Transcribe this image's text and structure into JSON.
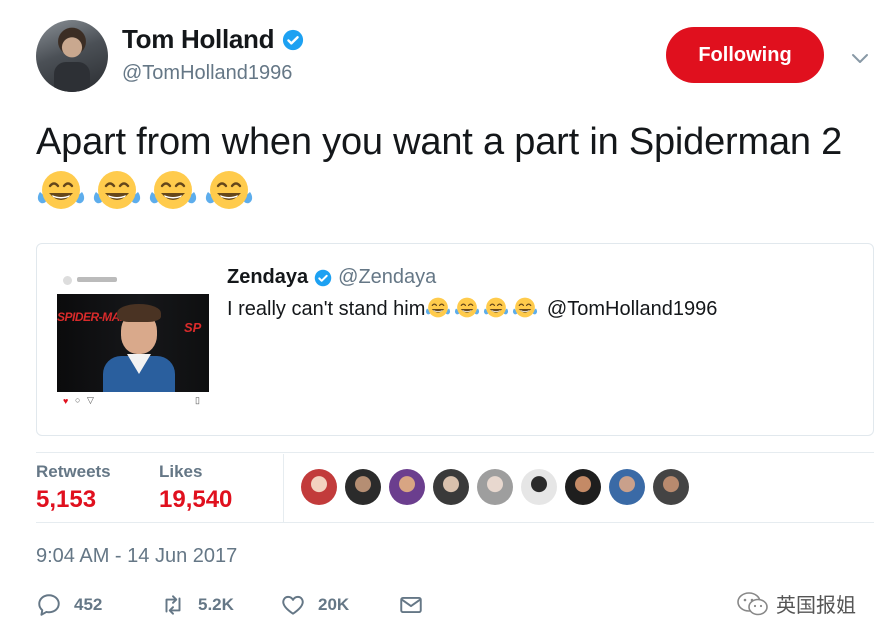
{
  "author": {
    "name": "Tom Holland",
    "handle": "@TomHolland1996",
    "verified": true
  },
  "follow_button": {
    "label": "Following",
    "color": "#e0101e"
  },
  "tweet": {
    "text": "Apart from when you want a part in Spiderman 2",
    "emoji_count": 4,
    "emoji": "face-with-tears-of-joy"
  },
  "quoted_tweet": {
    "name": "Zendaya",
    "handle": "@Zendaya",
    "verified": true,
    "text": "I really can't stand him",
    "emoji_count": 4,
    "mention": "@TomHolland1996",
    "image": {
      "logo_text": "SPIDER-MAN",
      "logo_text_right": "SP"
    }
  },
  "stats": {
    "retweets_label": "Retweets",
    "retweets_value": "5,153",
    "likes_label": "Likes",
    "likes_value": "19,540",
    "liker_count": 9
  },
  "timestamp": "9:04 AM - 14 Jun 2017",
  "actions": {
    "replies": "452",
    "retweets": "5.2K",
    "likes": "20K"
  },
  "watermark": "英国报姐",
  "colors": {
    "accent": "#e0101e",
    "verified": "#1da1f2",
    "muted": "#657786"
  }
}
